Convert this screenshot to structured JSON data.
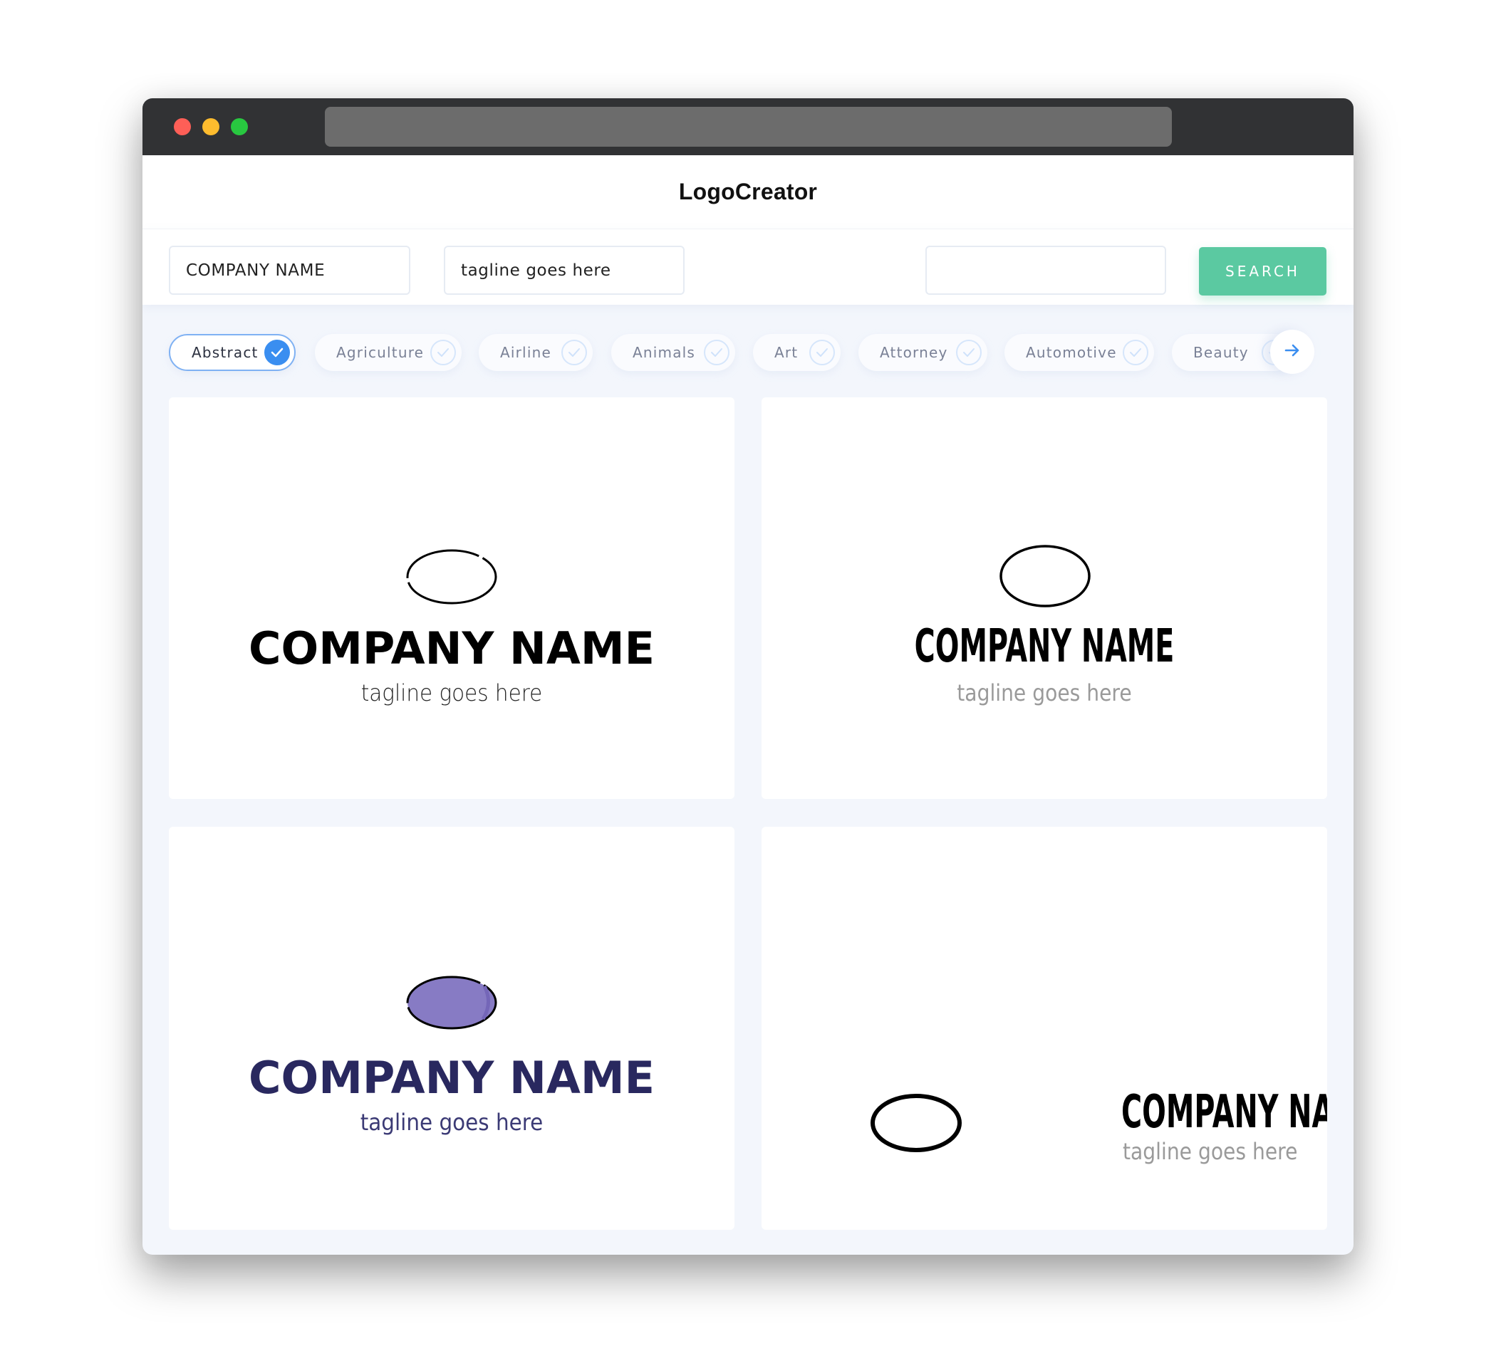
{
  "window": {
    "traffic_lights": [
      "close",
      "minimize",
      "maximize"
    ],
    "colors": {
      "close": "#fe5f57",
      "minimize": "#febc2e",
      "maximize": "#28c840"
    }
  },
  "header": {
    "brand": "LogoCreator"
  },
  "search": {
    "company_name_value": "COMPANY NAME",
    "tagline_value": "tagline goes here",
    "keyword_value": "",
    "button_label": "SEARCH",
    "button_color": "#5bc9a1"
  },
  "categories": [
    {
      "label": "Abstract",
      "selected": true
    },
    {
      "label": "Agriculture",
      "selected": false
    },
    {
      "label": "Airline",
      "selected": false
    },
    {
      "label": "Animals",
      "selected": false
    },
    {
      "label": "Art",
      "selected": false
    },
    {
      "label": "Attorney",
      "selected": false
    },
    {
      "label": "Automotive",
      "selected": false
    },
    {
      "label": "Beauty",
      "selected": false
    }
  ],
  "category_next_icon": "arrow-right-icon",
  "accent_color": "#3a8ef0",
  "logos": [
    {
      "company_name": "COMPANY NAME",
      "tagline": "tagline goes here",
      "icon": "ellipse-outline-broken",
      "name_color": "#000000",
      "layout": "stacked"
    },
    {
      "company_name": "COMPANY NAME",
      "tagline": "tagline goes here",
      "icon": "ellipse-outline",
      "name_color": "#000000",
      "layout": "stacked"
    },
    {
      "company_name": "COMPANY NAME",
      "tagline": "tagline goes here",
      "icon": "ellipse-filled-purple",
      "name_color": "#29285f",
      "fill_color": "#877bc4",
      "layout": "stacked"
    },
    {
      "company_name": "COMPANY NAME",
      "tagline": "tagline goes here",
      "icon": "ellipse-outline-thick",
      "name_color": "#000000",
      "layout": "inline"
    }
  ]
}
